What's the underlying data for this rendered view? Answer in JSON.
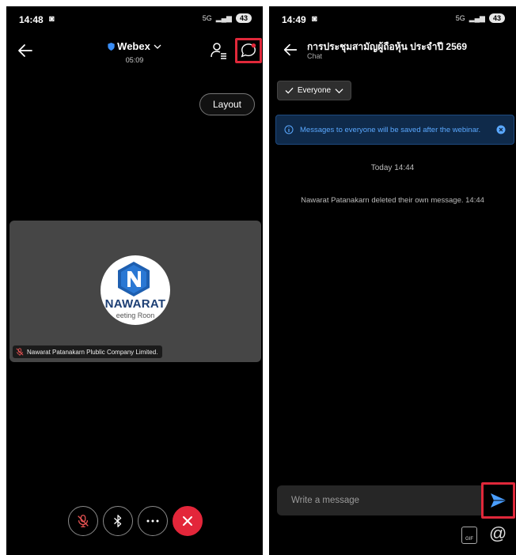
{
  "left_screen": {
    "status": {
      "time": "14:48",
      "network": "5G",
      "battery": "43"
    },
    "header": {
      "app_name": "Webex",
      "timer": "05:09"
    },
    "layout_label": "Layout",
    "participant": {
      "avatar_brand": "NAWARAT",
      "avatar_sub": "eeting Roon",
      "name_tag": "Nawarat Patanakarn Plublic Company Limited."
    },
    "controls": [
      "mic-muted-icon",
      "bluetooth-icon",
      "more-icon",
      "end-call-icon"
    ]
  },
  "right_screen": {
    "status": {
      "time": "14:49",
      "network": "5G",
      "battery": "43"
    },
    "header": {
      "title": "การประชุมสามัญผู้ถือหุ้น ประจำปี 2569",
      "subtitle": "Chat"
    },
    "recipient_label": "Everyone",
    "info_banner": "Messages to everyone will be saved after the webinar.",
    "date_separator": "Today 14:44",
    "system_message": "Nawarat Patanakarn deleted their own message. 14:44",
    "input_placeholder": "Write a message",
    "gif_label": "GIF"
  },
  "colors": {
    "highlight": "#e0283a",
    "end_call": "#e3263a",
    "banner_bg": "#0f2a4a",
    "banner_text": "#5aa8ff",
    "send_icon": "#4a9eff"
  }
}
